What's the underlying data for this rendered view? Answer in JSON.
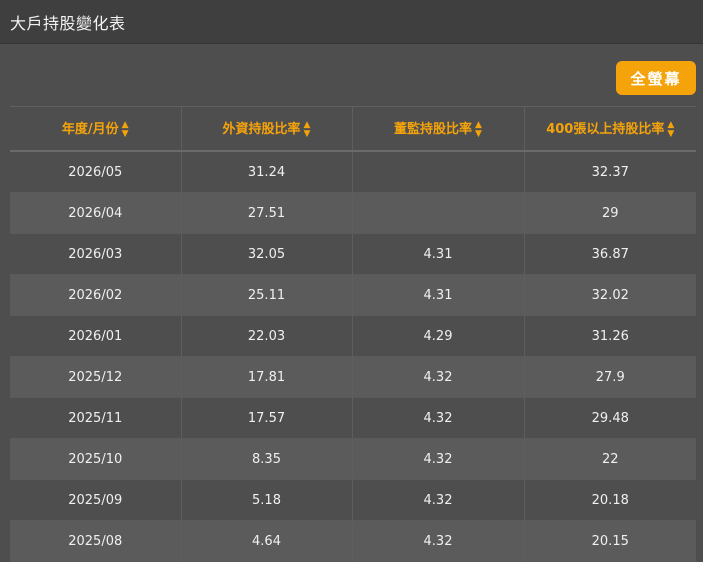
{
  "header": {
    "title": "大戶持股變化表"
  },
  "toolbar": {
    "fullscreen_label": "全螢幕"
  },
  "table": {
    "columns": [
      "年度/月份",
      "外資持股比率",
      "董監持股比率",
      "400張以上持股比率"
    ],
    "rows": [
      [
        "2026/05",
        "31.24",
        "",
        "32.37"
      ],
      [
        "2026/04",
        "27.51",
        "",
        "29"
      ],
      [
        "2026/03",
        "32.05",
        "4.31",
        "36.87"
      ],
      [
        "2026/02",
        "25.11",
        "4.31",
        "32.02"
      ],
      [
        "2026/01",
        "22.03",
        "4.29",
        "31.26"
      ],
      [
        "2025/12",
        "17.81",
        "4.32",
        "27.9"
      ],
      [
        "2025/11",
        "17.57",
        "4.32",
        "29.48"
      ],
      [
        "2025/10",
        "8.35",
        "4.32",
        "22"
      ],
      [
        "2025/09",
        "5.18",
        "4.32",
        "20.18"
      ],
      [
        "2025/08",
        "4.64",
        "4.32",
        "20.15"
      ]
    ]
  },
  "colors": {
    "accent": "#f5a30b",
    "background": "#4e4e4e",
    "row_alt": "#5b5b5b",
    "titlebar": "#3f3f3f"
  },
  "icons": {
    "sort": "sort-icon"
  }
}
